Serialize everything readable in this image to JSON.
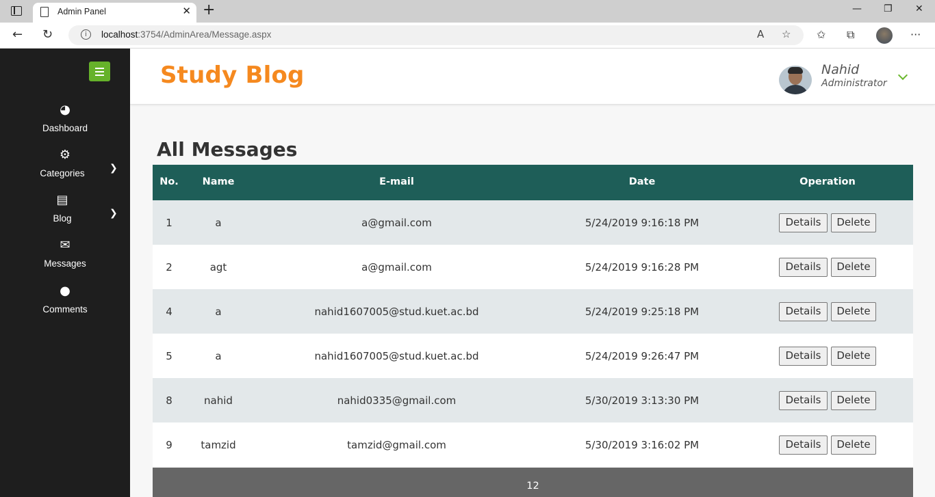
{
  "browser": {
    "tab_title": "Admin Panel",
    "url_host": "localhost",
    "url_rest": ":3754/AdminArea/Message.aspx",
    "tab_close": "✕",
    "new_tab": "+"
  },
  "sidebar": {
    "items": [
      {
        "label": "Dashboard",
        "icon": "dashboard-icon",
        "glyph": "◕"
      },
      {
        "label": "Categories",
        "icon": "cogs-icon",
        "glyph": "⚙"
      },
      {
        "label": "Blog",
        "icon": "book-icon",
        "glyph": "▤"
      },
      {
        "label": "Messages",
        "icon": "envelope-icon",
        "glyph": "✉"
      },
      {
        "label": "Comments",
        "icon": "comments-icon",
        "glyph": "●"
      }
    ]
  },
  "header": {
    "brand": "Study Blog",
    "user_name": "Nahid",
    "user_role": "Administrator"
  },
  "main": {
    "title": "All Messages",
    "columns": [
      "No.",
      "Name",
      "E-mail",
      "Date",
      "Operation"
    ],
    "rows": [
      {
        "no": "1",
        "name": "a",
        "email": "a@gmail.com",
        "date": "5/24/2019 9:16:18 PM"
      },
      {
        "no": "2",
        "name": "agt",
        "email": "a@gmail.com",
        "date": "5/24/2019 9:16:28 PM"
      },
      {
        "no": "4",
        "name": "a",
        "email": "nahid1607005@stud.kuet.ac.bd",
        "date": "5/24/2019 9:25:18 PM"
      },
      {
        "no": "5",
        "name": "a",
        "email": "nahid1607005@stud.kuet.ac.bd",
        "date": "5/24/2019 9:26:47 PM"
      },
      {
        "no": "8",
        "name": "nahid",
        "email": "nahid0335@gmail.com",
        "date": "5/30/2019 3:13:30 PM"
      },
      {
        "no": "9",
        "name": "tamzid",
        "email": "tamzid@gmail.com",
        "date": "5/30/2019 3:16:02 PM"
      }
    ],
    "details_label": "Details",
    "delete_label": "Delete",
    "pager": "12"
  },
  "colors": {
    "accent_green": "#66b22a",
    "brand_orange": "#f5891f",
    "table_header": "#1e5e58",
    "sidebar_bg": "#1e1e1e"
  }
}
